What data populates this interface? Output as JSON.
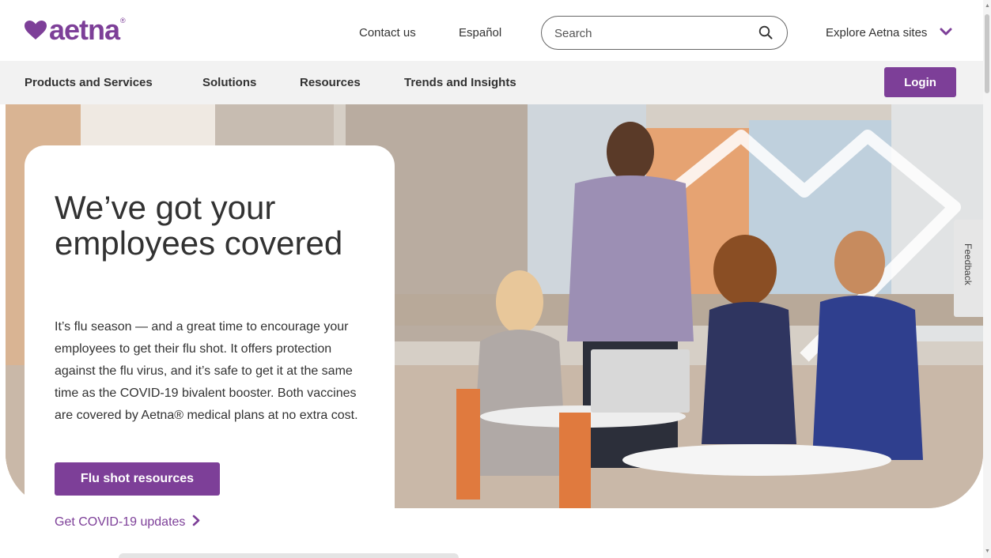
{
  "brand": {
    "logo_text": "aetna",
    "registered_mark": "®",
    "accent_color": "#7d3f98",
    "icon": "heart-icon"
  },
  "topbar": {
    "contact_label": "Contact us",
    "espanol_label": "Español",
    "search_placeholder": "Search",
    "search_icon": "search-icon",
    "explore_label": "Explore Aetna sites",
    "explore_icon": "chevron-down-icon"
  },
  "nav": {
    "items": [
      {
        "label": "Products and Services"
      },
      {
        "label": "Solutions"
      },
      {
        "label": "Resources"
      },
      {
        "label": "Trends and Insights"
      }
    ],
    "login_label": "Login"
  },
  "hero": {
    "title": "We’ve got your employees covered",
    "body": "It’s flu season — and a great time to encourage your employees to get their flu shot. It offers protection against the flu virus, and it’s safe to get it at the same time as the COVID-19 bivalent booster. Both vaccines are covered by Aetna® medical plans at no extra cost.",
    "cta_label": "Flu shot resources",
    "link_label": "Get COVID-19 updates",
    "link_icon": "chevron-right-icon"
  },
  "feedback": {
    "label": "Feedback"
  }
}
